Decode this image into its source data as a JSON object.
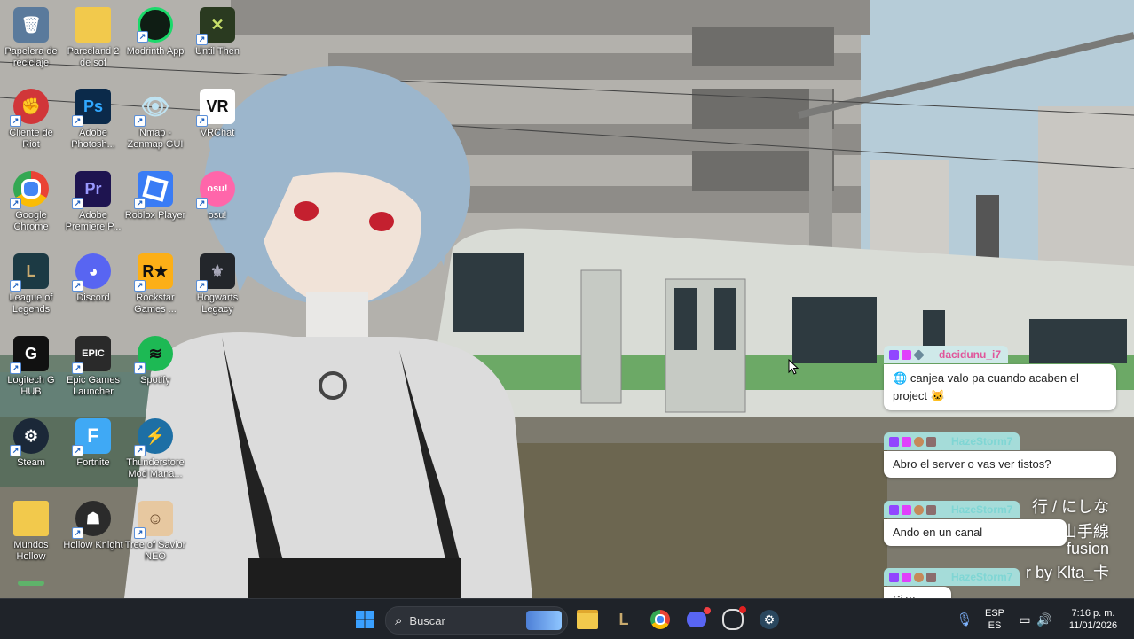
{
  "desktop": {
    "icons": [
      {
        "label": "Papelera de reciclaje",
        "icon": "recycle-bin-icon",
        "color": "#6f8fb0"
      },
      {
        "label": "Parceland 2 de sof",
        "icon": "folder-icon",
        "color": "#f2c94c"
      },
      {
        "label": "Modrinth App",
        "icon": "modrinth-icon",
        "color": "#1bd96a"
      },
      {
        "label": "Until Then",
        "icon": "until-then-icon",
        "color": "#2a3a20"
      },
      {
        "label": "Cliente de Riot",
        "icon": "riot-client-icon",
        "color": "#d13639"
      },
      {
        "label": "Adobe Photosh...",
        "icon": "photoshop-icon",
        "color": "#0b2a4a"
      },
      {
        "label": "Nmap - Zenmap GUI",
        "icon": "nmap-eye-icon",
        "color": "#bfe3f2"
      },
      {
        "label": "VRChat",
        "icon": "vrchat-icon",
        "color": "#ffffff"
      },
      {
        "label": "Google Chrome",
        "icon": "chrome-icon",
        "color": "#ea4335"
      },
      {
        "label": "Adobe Premiere P...",
        "icon": "premiere-icon",
        "color": "#1e1450"
      },
      {
        "label": "Roblox Player",
        "icon": "roblox-icon",
        "color": "#3a7cf5"
      },
      {
        "label": "osu!",
        "icon": "osu-icon",
        "color": "#ff66aa"
      },
      {
        "label": "League of Legends",
        "icon": "league-icon",
        "color": "#1c3a44"
      },
      {
        "label": "Discord",
        "icon": "discord-icon",
        "color": "#5865f2"
      },
      {
        "label": "Rockstar Games ...",
        "icon": "rockstar-icon",
        "color": "#fcaf17"
      },
      {
        "label": "Hogwarts Legacy",
        "icon": "hogwarts-icon",
        "color": "#23262b"
      },
      {
        "label": "Logitech G HUB",
        "icon": "logitech-icon",
        "color": "#111111"
      },
      {
        "label": "Epic Games Launcher",
        "icon": "epic-games-icon",
        "color": "#2a2a2a"
      },
      {
        "label": "Spotify",
        "icon": "spotify-icon",
        "color": "#1db954"
      },
      {
        "label": "Steam",
        "icon": "steam-icon",
        "color": "#1b2838"
      },
      {
        "label": "Fortnite",
        "icon": "fortnite-icon",
        "color": "#3fa9f5"
      },
      {
        "label": "Thunderstore Mod Mana...",
        "icon": "thunderstore-icon",
        "color": "#1d6fa5"
      },
      {
        "label": "Mundos Hollow",
        "icon": "folder-icon",
        "color": "#f2c94c"
      },
      {
        "label": "Hollow Knight",
        "icon": "hollow-knight-icon",
        "color": "#2b2b2b"
      },
      {
        "label": "Tree of Savior NEO",
        "icon": "tree-of-savior-icon",
        "color": "#e7c8a0"
      }
    ]
  },
  "icon_text": {
    "photoshop": "Ps",
    "premiere": "Pr",
    "vrchat": "VR",
    "osu": "osu!",
    "epic": "EPIC",
    "rockstar": "R★",
    "fortnite": "F"
  },
  "wallpaper_text": {
    "line1": "行 / にしな",
    "line2": "山手線",
    "line3": "fusion",
    "line4": "r by Klta_卡"
  },
  "chat": {
    "messages": [
      {
        "user": "dacidunu_i7",
        "text": "canjea valo pa cuando acaben el project",
        "user_color": "#e0569b",
        "head_bg": "#cfe9e9"
      },
      {
        "user": "HazeStorm7",
        "text": "Abro el server o vas ver tistos?",
        "user_color": "#7fd6d4",
        "head_bg": "#a5dcd9"
      },
      {
        "user": "HazeStorm7",
        "text": "Ando en un canal",
        "user_color": "#7fd6d4",
        "head_bg": "#a5dcd9"
      },
      {
        "user": "HazeStorm7",
        "text": "Si w",
        "user_color": "#7fd6d4",
        "head_bg": "#a5dcd9"
      }
    ]
  },
  "taskbar": {
    "search_placeholder": "Buscar",
    "language": "ESP",
    "region": "ES",
    "time": "7:16 p. m.",
    "date": "11/01/2026",
    "pinned": [
      "start-icon",
      "file-explorer-icon",
      "league-icon",
      "chrome-icon",
      "discord-icon",
      "obs-icon",
      "steam-icon"
    ]
  },
  "colors": {
    "taskbar_bg": "#1f2329",
    "sky": "#a9c6d6",
    "train_green": "#5fa35a"
  }
}
